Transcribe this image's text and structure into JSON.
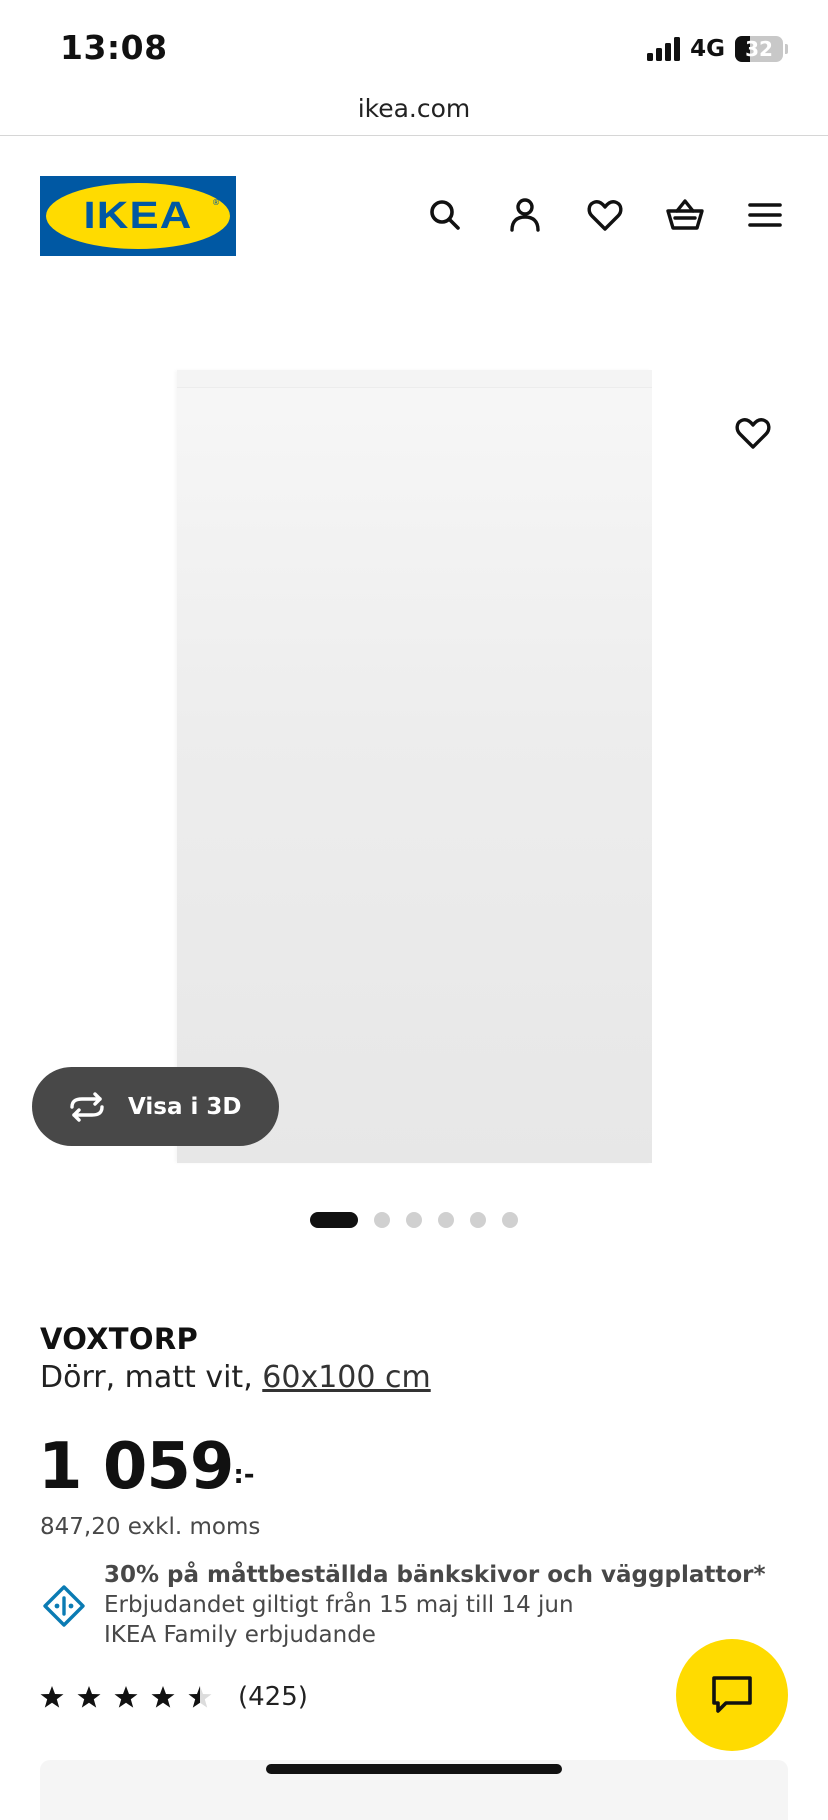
{
  "status_bar": {
    "time": "13:08",
    "network": "4G",
    "battery": "32"
  },
  "browser": {
    "url": "ikea.com"
  },
  "header": {
    "logo_text": "IKEA",
    "icons": [
      "search-icon",
      "account-icon",
      "favourites-icon",
      "basket-icon",
      "menu-icon"
    ]
  },
  "gallery": {
    "view_3d_label": "Visa i 3D",
    "image_count": 6,
    "active_index": 0
  },
  "product": {
    "name": "VOXTORP",
    "description": "Dörr, matt vit, ",
    "size": "60x100 cm",
    "price": "1 059",
    "price_suffix": ":-",
    "price_ex_vat": "847,20 exkl. moms"
  },
  "offer": {
    "title": "30% på måttbeställda bänkskivor och väggplattor*",
    "validity": "Erbjudandet giltigt från 15 maj till 14 jun",
    "program": "IKEA Family erbjudande"
  },
  "rating": {
    "stars": 4.5,
    "max": 5,
    "count": "(425)"
  },
  "colors": {
    "ikea_blue": "#0058a3",
    "ikea_yellow": "#ffdb00",
    "offer_icon": "#0a7bb3"
  }
}
